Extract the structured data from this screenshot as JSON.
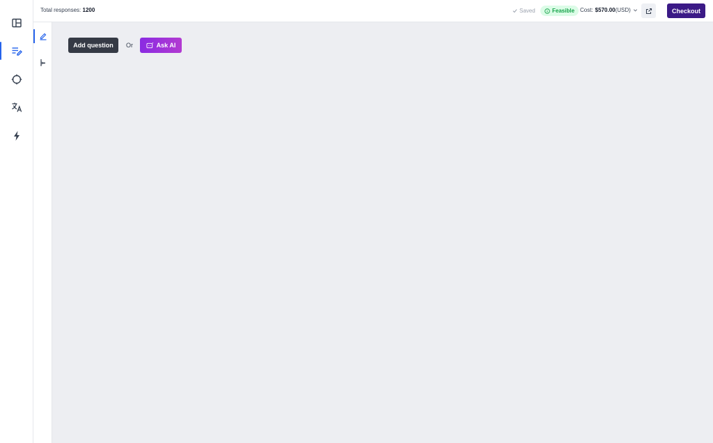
{
  "header": {
    "total_label": "Total responses:",
    "total_value": "1200",
    "saved_label": "Saved",
    "feasible_label": "Feasible",
    "cost_label": "Cost:",
    "cost_amount": "$570.00",
    "cost_currency": "(USD)",
    "checkout_label": "Checkout"
  },
  "canvas": {
    "add_question_label": "Add question",
    "or_label": "Or",
    "ask_ai_label": "Ask AI"
  },
  "sidebar": {
    "items": [
      {
        "icon": "layout-panel-icon"
      },
      {
        "icon": "edit-list-icon",
        "active": true
      },
      {
        "icon": "target-crosshair-icon"
      },
      {
        "icon": "translate-icon"
      },
      {
        "icon": "lightning-icon"
      }
    ]
  },
  "subrail": {
    "items": [
      {
        "icon": "pencil-icon",
        "active": true
      },
      {
        "icon": "branch-logic-icon"
      }
    ]
  },
  "colors": {
    "accent": "#2563eb",
    "checkout": "#3b1a86",
    "ask_ai": "#9b30d9",
    "feasible_bg": "#dcfce7",
    "feasible_text": "#16a34a",
    "canvas_bg": "#edeef2"
  }
}
